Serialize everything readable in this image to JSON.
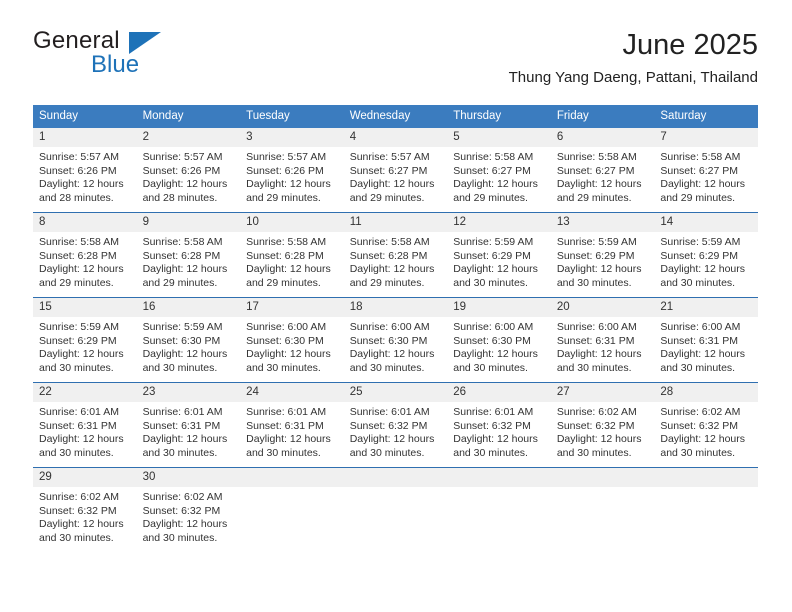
{
  "brand": {
    "name_top": "General",
    "name_bottom": "Blue",
    "accent_color": "#1e72b8"
  },
  "header": {
    "title": "June 2025",
    "subtitle": "Thung Yang Daeng, Pattani, Thailand"
  },
  "theme": {
    "header_blue": "#3b7cbf",
    "row_rule_blue": "#2f6fb0",
    "day_band_gray": "#f0f0f0",
    "text": "#333333"
  },
  "calendar": {
    "weekday_headers": [
      "Sunday",
      "Monday",
      "Tuesday",
      "Wednesday",
      "Thursday",
      "Friday",
      "Saturday"
    ],
    "labels": {
      "sunrise": "Sunrise:",
      "sunset": "Sunset:",
      "daylight": "Daylight:"
    },
    "weeks": [
      [
        {
          "day": "1",
          "sunrise": "Sunrise: 5:57 AM",
          "sunset": "Sunset: 6:26 PM",
          "daylight": "Daylight: 12 hours and 28 minutes."
        },
        {
          "day": "2",
          "sunrise": "Sunrise: 5:57 AM",
          "sunset": "Sunset: 6:26 PM",
          "daylight": "Daylight: 12 hours and 28 minutes."
        },
        {
          "day": "3",
          "sunrise": "Sunrise: 5:57 AM",
          "sunset": "Sunset: 6:26 PM",
          "daylight": "Daylight: 12 hours and 29 minutes."
        },
        {
          "day": "4",
          "sunrise": "Sunrise: 5:57 AM",
          "sunset": "Sunset: 6:27 PM",
          "daylight": "Daylight: 12 hours and 29 minutes."
        },
        {
          "day": "5",
          "sunrise": "Sunrise: 5:58 AM",
          "sunset": "Sunset: 6:27 PM",
          "daylight": "Daylight: 12 hours and 29 minutes."
        },
        {
          "day": "6",
          "sunrise": "Sunrise: 5:58 AM",
          "sunset": "Sunset: 6:27 PM",
          "daylight": "Daylight: 12 hours and 29 minutes."
        },
        {
          "day": "7",
          "sunrise": "Sunrise: 5:58 AM",
          "sunset": "Sunset: 6:27 PM",
          "daylight": "Daylight: 12 hours and 29 minutes."
        }
      ],
      [
        {
          "day": "8",
          "sunrise": "Sunrise: 5:58 AM",
          "sunset": "Sunset: 6:28 PM",
          "daylight": "Daylight: 12 hours and 29 minutes."
        },
        {
          "day": "9",
          "sunrise": "Sunrise: 5:58 AM",
          "sunset": "Sunset: 6:28 PM",
          "daylight": "Daylight: 12 hours and 29 minutes."
        },
        {
          "day": "10",
          "sunrise": "Sunrise: 5:58 AM",
          "sunset": "Sunset: 6:28 PM",
          "daylight": "Daylight: 12 hours and 29 minutes."
        },
        {
          "day": "11",
          "sunrise": "Sunrise: 5:58 AM",
          "sunset": "Sunset: 6:28 PM",
          "daylight": "Daylight: 12 hours and 29 minutes."
        },
        {
          "day": "12",
          "sunrise": "Sunrise: 5:59 AM",
          "sunset": "Sunset: 6:29 PM",
          "daylight": "Daylight: 12 hours and 30 minutes."
        },
        {
          "day": "13",
          "sunrise": "Sunrise: 5:59 AM",
          "sunset": "Sunset: 6:29 PM",
          "daylight": "Daylight: 12 hours and 30 minutes."
        },
        {
          "day": "14",
          "sunrise": "Sunrise: 5:59 AM",
          "sunset": "Sunset: 6:29 PM",
          "daylight": "Daylight: 12 hours and 30 minutes."
        }
      ],
      [
        {
          "day": "15",
          "sunrise": "Sunrise: 5:59 AM",
          "sunset": "Sunset: 6:29 PM",
          "daylight": "Daylight: 12 hours and 30 minutes."
        },
        {
          "day": "16",
          "sunrise": "Sunrise: 5:59 AM",
          "sunset": "Sunset: 6:30 PM",
          "daylight": "Daylight: 12 hours and 30 minutes."
        },
        {
          "day": "17",
          "sunrise": "Sunrise: 6:00 AM",
          "sunset": "Sunset: 6:30 PM",
          "daylight": "Daylight: 12 hours and 30 minutes."
        },
        {
          "day": "18",
          "sunrise": "Sunrise: 6:00 AM",
          "sunset": "Sunset: 6:30 PM",
          "daylight": "Daylight: 12 hours and 30 minutes."
        },
        {
          "day": "19",
          "sunrise": "Sunrise: 6:00 AM",
          "sunset": "Sunset: 6:30 PM",
          "daylight": "Daylight: 12 hours and 30 minutes."
        },
        {
          "day": "20",
          "sunrise": "Sunrise: 6:00 AM",
          "sunset": "Sunset: 6:31 PM",
          "daylight": "Daylight: 12 hours and 30 minutes."
        },
        {
          "day": "21",
          "sunrise": "Sunrise: 6:00 AM",
          "sunset": "Sunset: 6:31 PM",
          "daylight": "Daylight: 12 hours and 30 minutes."
        }
      ],
      [
        {
          "day": "22",
          "sunrise": "Sunrise: 6:01 AM",
          "sunset": "Sunset: 6:31 PM",
          "daylight": "Daylight: 12 hours and 30 minutes."
        },
        {
          "day": "23",
          "sunrise": "Sunrise: 6:01 AM",
          "sunset": "Sunset: 6:31 PM",
          "daylight": "Daylight: 12 hours and 30 minutes."
        },
        {
          "day": "24",
          "sunrise": "Sunrise: 6:01 AM",
          "sunset": "Sunset: 6:31 PM",
          "daylight": "Daylight: 12 hours and 30 minutes."
        },
        {
          "day": "25",
          "sunrise": "Sunrise: 6:01 AM",
          "sunset": "Sunset: 6:32 PM",
          "daylight": "Daylight: 12 hours and 30 minutes."
        },
        {
          "day": "26",
          "sunrise": "Sunrise: 6:01 AM",
          "sunset": "Sunset: 6:32 PM",
          "daylight": "Daylight: 12 hours and 30 minutes."
        },
        {
          "day": "27",
          "sunrise": "Sunrise: 6:02 AM",
          "sunset": "Sunset: 6:32 PM",
          "daylight": "Daylight: 12 hours and 30 minutes."
        },
        {
          "day": "28",
          "sunrise": "Sunrise: 6:02 AM",
          "sunset": "Sunset: 6:32 PM",
          "daylight": "Daylight: 12 hours and 30 minutes."
        }
      ],
      [
        {
          "day": "29",
          "sunrise": "Sunrise: 6:02 AM",
          "sunset": "Sunset: 6:32 PM",
          "daylight": "Daylight: 12 hours and 30 minutes."
        },
        {
          "day": "30",
          "sunrise": "Sunrise: 6:02 AM",
          "sunset": "Sunset: 6:32 PM",
          "daylight": "Daylight: 12 hours and 30 minutes."
        },
        {
          "day": "",
          "sunrise": "",
          "sunset": "",
          "daylight": ""
        },
        {
          "day": "",
          "sunrise": "",
          "sunset": "",
          "daylight": ""
        },
        {
          "day": "",
          "sunrise": "",
          "sunset": "",
          "daylight": ""
        },
        {
          "day": "",
          "sunrise": "",
          "sunset": "",
          "daylight": ""
        },
        {
          "day": "",
          "sunrise": "",
          "sunset": "",
          "daylight": ""
        }
      ]
    ]
  }
}
